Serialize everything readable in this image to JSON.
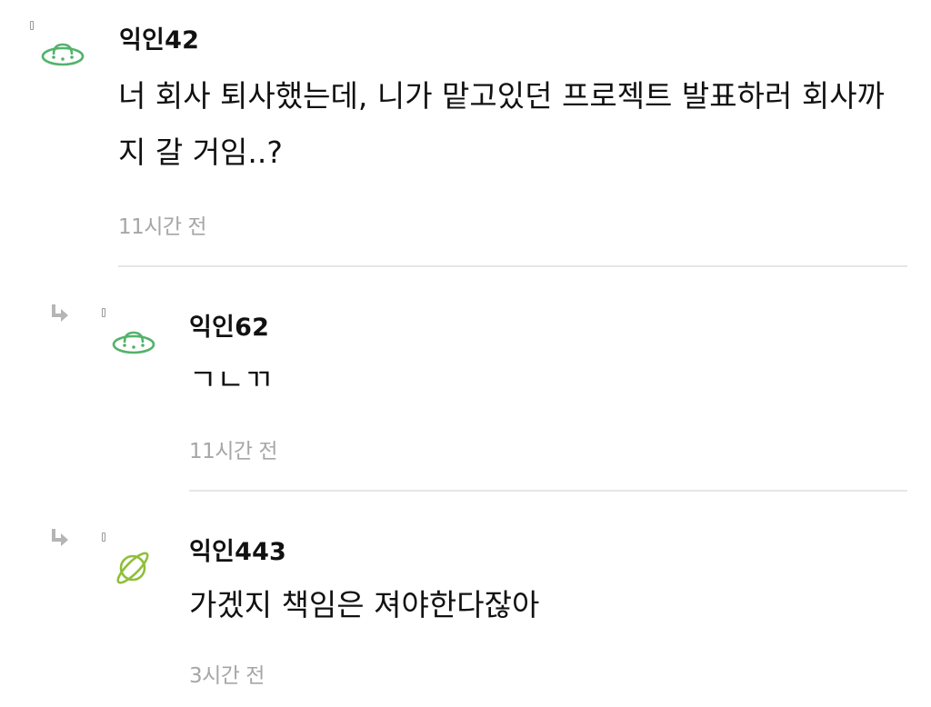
{
  "comments": [
    {
      "author": "익인42",
      "text": "너 회사 퇴사했는데, 니가 맡고있던 프로젝트 발표하러 회사까지 갈 거임..?",
      "time": "11시간 전",
      "avatar_icon": "ufo-icon",
      "avatar_color": "#52b36a",
      "is_reply": false
    },
    {
      "author": "익인62",
      "text": "ㄱㄴㄲ",
      "time": "11시간 전",
      "avatar_icon": "ufo-icon",
      "avatar_color": "#52b36a",
      "is_reply": true
    },
    {
      "author": "익인443",
      "text": "가겠지 책임은 져야한다잖아",
      "time": "3시간 전",
      "avatar_icon": "planet-icon",
      "avatar_color": "#8fbf3a",
      "is_reply": true
    }
  ],
  "colors": {
    "text": "#111111",
    "time": "#a6a6a6",
    "divider": "#e6e6e6",
    "reply_arrow": "#b5b5b5"
  }
}
